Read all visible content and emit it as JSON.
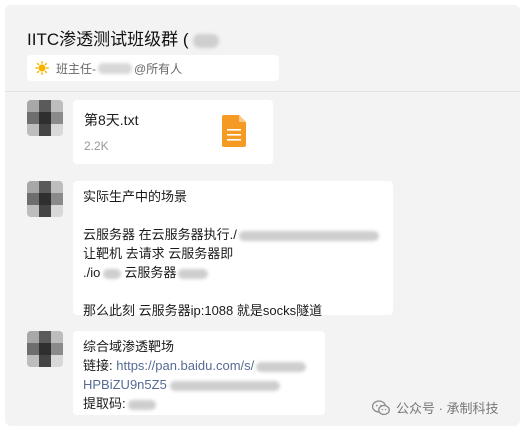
{
  "chat": {
    "title": "IITC渗透测试班级群 (",
    "notice": {
      "prefix": "班主任-",
      "suffix": "@所有人"
    }
  },
  "messages": [
    {
      "type": "file",
      "file_name": "第8天.txt",
      "file_size": "2.2K"
    },
    {
      "type": "text",
      "lines": [
        "实际生产中的场景",
        "",
        "云服务器 在云服务器执行./",
        "让靶机 去请求 云服务器即",
        "./io",
        "",
        "那么此刻 云服务器ip:1088 就是socks隧道"
      ],
      "line3_tail": "云服务器"
    },
    {
      "type": "text",
      "lines": [
        "综合域渗透靶场",
        "链接: ",
        "HPBiZU9n5Z5",
        "提取码:"
      ],
      "link_url": "https://pan.baidu.com/s/"
    }
  ],
  "watermark": {
    "text": "公众号 · 承制科技"
  },
  "colors": {
    "background": "#f3f3f3",
    "bubble": "#ffffff",
    "link": "#576b95",
    "file_icon": "#f59a23"
  }
}
